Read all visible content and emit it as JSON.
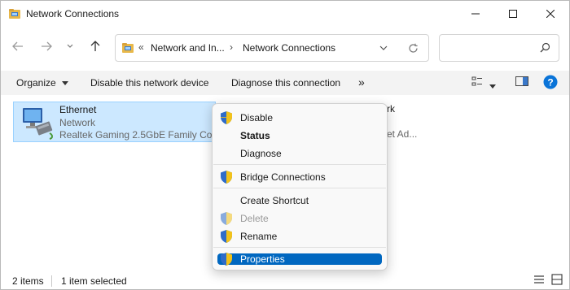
{
  "window": {
    "title": "Network Connections",
    "icon": "network-folder-icon"
  },
  "title_buttons": {
    "minimize": "minimize-icon",
    "maximize": "maximize-icon",
    "close": "close-icon"
  },
  "nav": {
    "back": "back-arrow-icon",
    "forward": "forward-arrow-icon",
    "recent": "chevron-down-icon",
    "up": "up-arrow-icon"
  },
  "address": {
    "overflow": "«",
    "crumbs": [
      "Network and In...",
      "Network Connections"
    ],
    "separator": "›"
  },
  "search": {
    "placeholder": "",
    "icon": "search-icon"
  },
  "commandbar": {
    "organize": "Organize",
    "disable": "Disable this network device",
    "diagnose": "Diagnose this connection",
    "more": "»"
  },
  "items": [
    {
      "name": "Ethernet",
      "status": "Network",
      "device": "Realtek Gaming 2.5GbE Family Co..."
    }
  ],
  "background_item": {
    "name_tail": "rk",
    "device_tail": "et Ad..."
  },
  "context_menu": {
    "items": [
      {
        "label": "Disable",
        "shield": true,
        "bold": false,
        "enabled": true
      },
      {
        "label": "Status",
        "shield": false,
        "bold": true,
        "enabled": true
      },
      {
        "label": "Diagnose",
        "shield": false,
        "bold": false,
        "enabled": true
      },
      {
        "label": "Bridge Connections",
        "shield": true,
        "bold": false,
        "enabled": true
      },
      {
        "label": "Create Shortcut",
        "shield": false,
        "bold": false,
        "enabled": true
      },
      {
        "label": "Delete",
        "shield": true,
        "bold": false,
        "enabled": false
      },
      {
        "label": "Rename",
        "shield": true,
        "bold": false,
        "enabled": true
      },
      {
        "label": "Properties",
        "shield": true,
        "bold": false,
        "enabled": true,
        "highlighted": true
      }
    ]
  },
  "statusbar": {
    "count": "2 items",
    "selected": "1 item selected"
  },
  "colors": {
    "accent": "#0067c0",
    "selection": "#cce8ff",
    "commandbar": "#f3f3f3",
    "help": "#0a74d8"
  }
}
